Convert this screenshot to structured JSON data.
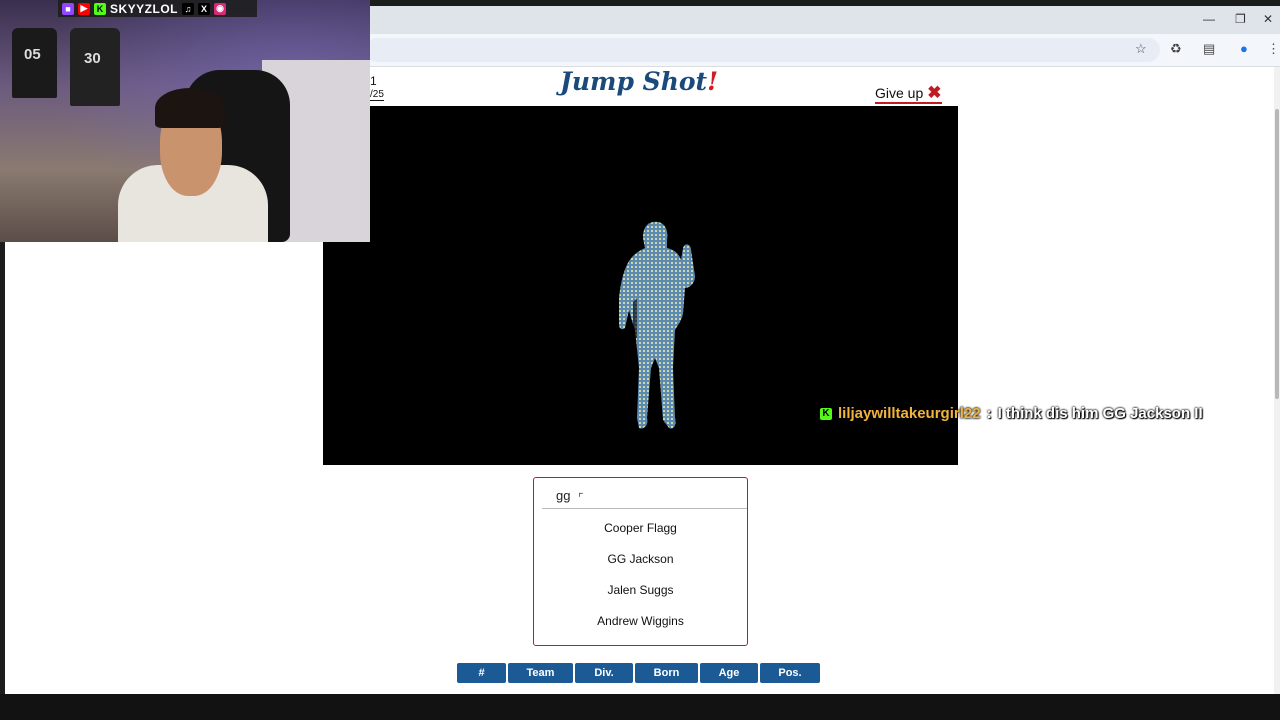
{
  "game": {
    "title": "Jump Shot",
    "title_bang": "!",
    "counter_top": "1",
    "counter_bottom": "/25",
    "give_up_label": "Give up",
    "give_up_icon": "close-icon"
  },
  "search": {
    "value": "gg",
    "suggestions": [
      "Cooper Flagg",
      "GG Jackson",
      "Jalen Suggs",
      "Andrew Wiggins"
    ]
  },
  "hints": [
    "#",
    "Team",
    "Div.",
    "Born",
    "Age",
    "Pos."
  ],
  "stream": {
    "handle": "SKYYZLOL",
    "social_icons": [
      "twitch-icon",
      "youtube-icon",
      "kick-icon",
      "tiktok-icon",
      "x-icon",
      "instagram-icon"
    ],
    "jersey_numbers": [
      "05",
      "30"
    ],
    "chat": {
      "platform_icon": "kick-icon",
      "user": "liljaywilltakeurgirl22",
      "separator": ":",
      "message": "I think dis him GG Jackson II"
    }
  },
  "colors": {
    "title": "#1a4a7a",
    "accent": "#d01c24",
    "hint_bg": "#1c5a96",
    "kick": "#53fc18",
    "chat_user": "#f2b33d"
  }
}
